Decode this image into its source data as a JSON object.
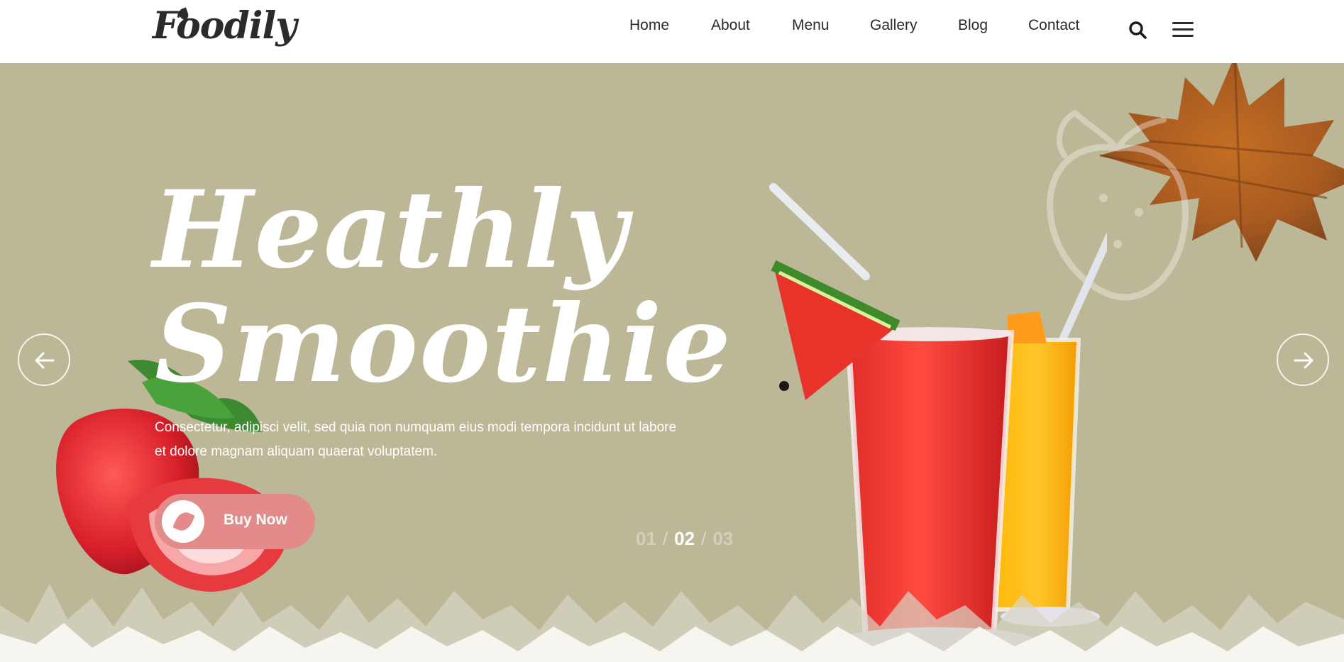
{
  "header": {
    "logo_text": "Foodily",
    "nav": [
      "Home",
      "About",
      "Menu",
      "Gallery",
      "Blog",
      "Contact"
    ],
    "search_icon": "search-icon",
    "menu_icon": "hamburger-icon"
  },
  "hero": {
    "title_line_1": "Heathly",
    "title_line_2": "Smoothie",
    "description": "Consectetur, adipisci velit, sed quia non numquam eius modi tempora incidunt ut labore et dolore magnam aliquam quaerat voluptatem.",
    "buy_button_label": "Buy Now",
    "prev_icon": "arrow-left-icon",
    "next_icon": "arrow-right-icon",
    "pager": {
      "prev": "01",
      "current": "02",
      "next": "03"
    }
  },
  "colors": {
    "hero_background": "#bcb796",
    "button_accent": "#e38b8b",
    "text_dark": "#2b2b2b",
    "text_light": "#ffffff"
  }
}
